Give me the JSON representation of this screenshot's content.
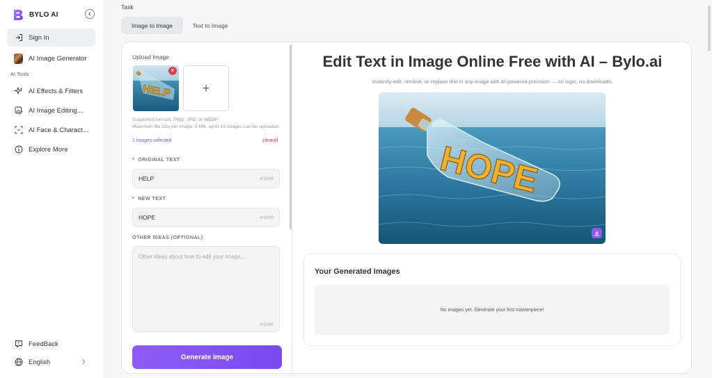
{
  "sidebar": {
    "brand": "BYLO AI",
    "sign_in": "Sign In",
    "generator": "AI Image Generator",
    "section": "AI Tools",
    "items": [
      {
        "label": "AI Effects & Filters",
        "icon": "sparkles-icon"
      },
      {
        "label": "AI Image Editing...",
        "icon": "image-edit-icon"
      },
      {
        "label": "AI Face & Charact...",
        "icon": "face-scan-icon"
      },
      {
        "label": "Explore More",
        "icon": "info-circle-icon"
      }
    ],
    "feedback": "FeedBack",
    "language": "English"
  },
  "task": {
    "label": "Task",
    "tabs": [
      {
        "label": "Image to Image",
        "active": true
      },
      {
        "label": "Text to Image",
        "active": false
      }
    ]
  },
  "form": {
    "upload_label": "Upload Image",
    "thumb_text": "HELP",
    "formats": "Supported formats: PNG, JPG, or WEBP",
    "max_size": "Maximum file size per image: 5 MB, up to 10 images can be uploaded.",
    "selected": "1 images selected",
    "clearall": "clearall",
    "original_label": "ORIGINAL TEXT",
    "original_value": "HELP",
    "original_count": "4/2000",
    "new_label": "NEW TEXT",
    "new_value": "HOPE",
    "new_count": "4/2000",
    "ideas_label": "OTHER IDEAS (OPTIONAL)",
    "ideas_placeholder": "Other ideas about how to edit your image...",
    "ideas_count": "0/2000",
    "generate_button": "Generate Image"
  },
  "main": {
    "headline": "Edit Text in Image Online Free with AI – Bylo.ai",
    "subline": "Instantly edit, remove, or replace text in any image with AI-powered precision — no login, no downloads.",
    "hero_text": "HOPE",
    "generated_title": "Your Generated Images",
    "empty_message": "No images yet. Generate your first masterpiece!"
  },
  "colors": {
    "accent": "#8b5cf6",
    "danger": "#e53950"
  }
}
